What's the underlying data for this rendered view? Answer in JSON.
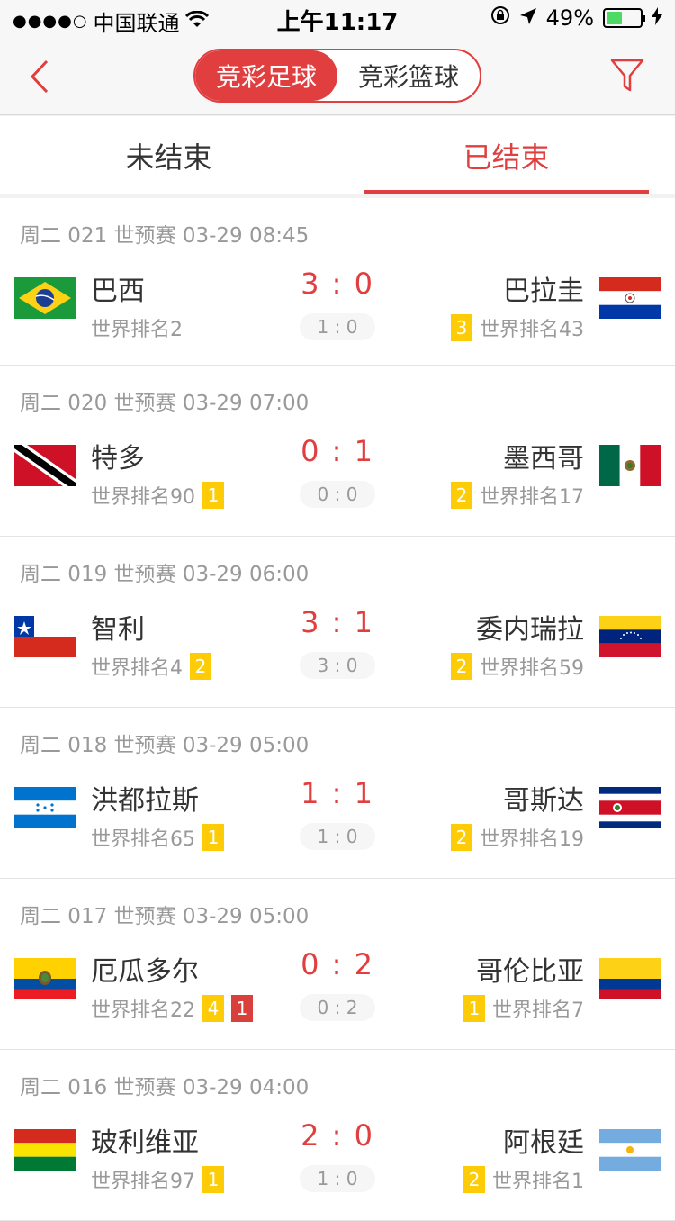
{
  "status_bar": {
    "signal": "●●●●○",
    "carrier": "中国联通",
    "time": "上午11:17",
    "battery_percent": "49%",
    "battery_level": 0.49
  },
  "nav": {
    "seg_football": "竞彩足球",
    "seg_basketball": "竞彩篮球",
    "back_icon": "chevron-left-icon",
    "filter_icon": "funnel-icon"
  },
  "tabs": {
    "unfinished": "未结束",
    "finished": "已结束"
  },
  "colors": {
    "accent": "#e03e3f",
    "yellow_card": "#fdcc06",
    "red_card": "#d9403b",
    "muted": "#999999",
    "half_bg": "#f6f6f6"
  },
  "matches": [
    {
      "header": "周二 021 世预赛 03-29 08:45",
      "home": {
        "name": "巴西",
        "rank": "世界排名2",
        "flag": "brazil-flag-icon",
        "cards": []
      },
      "away": {
        "name": "巴拉圭",
        "rank": "世界排名43",
        "flag": "paraguay-flag-icon",
        "cards": [
          {
            "n": "3",
            "type": "yellow"
          }
        ]
      },
      "score": "3 : 0",
      "half": "1 : 0"
    },
    {
      "header": "周二 020 世预赛 03-29 07:00",
      "home": {
        "name": "特多",
        "rank": "世界排名90",
        "flag": "trinidad-flag-icon",
        "cards": [
          {
            "n": "1",
            "type": "yellow"
          }
        ]
      },
      "away": {
        "name": "墨西哥",
        "rank": "世界排名17",
        "flag": "mexico-flag-icon",
        "cards": [
          {
            "n": "2",
            "type": "yellow"
          }
        ]
      },
      "score": "0 : 1",
      "half": "0 : 0"
    },
    {
      "header": "周二 019 世预赛 03-29 06:00",
      "home": {
        "name": "智利",
        "rank": "世界排名4",
        "flag": "chile-flag-icon",
        "cards": [
          {
            "n": "2",
            "type": "yellow"
          }
        ]
      },
      "away": {
        "name": "委内瑞拉",
        "rank": "世界排名59",
        "flag": "venezuela-flag-icon",
        "cards": [
          {
            "n": "2",
            "type": "yellow"
          }
        ]
      },
      "score": "3 : 1",
      "half": "3 : 0"
    },
    {
      "header": "周二 018 世预赛 03-29 05:00",
      "home": {
        "name": "洪都拉斯",
        "rank": "世界排名65",
        "flag": "honduras-flag-icon",
        "cards": [
          {
            "n": "1",
            "type": "yellow"
          }
        ]
      },
      "away": {
        "name": "哥斯达",
        "rank": "世界排名19",
        "flag": "costa-rica-flag-icon",
        "cards": [
          {
            "n": "2",
            "type": "yellow"
          }
        ]
      },
      "score": "1 : 1",
      "half": "1 : 0"
    },
    {
      "header": "周二 017 世预赛 03-29 05:00",
      "home": {
        "name": "厄瓜多尔",
        "rank": "世界排名22",
        "flag": "ecuador-flag-icon",
        "cards": [
          {
            "n": "4",
            "type": "yellow"
          },
          {
            "n": "1",
            "type": "red"
          }
        ]
      },
      "away": {
        "name": "哥伦比亚",
        "rank": "世界排名7",
        "flag": "colombia-flag-icon",
        "cards": [
          {
            "n": "1",
            "type": "yellow"
          }
        ]
      },
      "score": "0 : 2",
      "half": "0 : 2"
    },
    {
      "header": "周二 016 世预赛 03-29 04:00",
      "home": {
        "name": "玻利维亚",
        "rank": "世界排名97",
        "flag": "bolivia-flag-icon",
        "cards": [
          {
            "n": "1",
            "type": "yellow"
          }
        ]
      },
      "away": {
        "name": "阿根廷",
        "rank": "世界排名1",
        "flag": "argentina-flag-icon",
        "cards": [
          {
            "n": "2",
            "type": "yellow"
          }
        ]
      },
      "score": "2 : 0",
      "half": "1 : 0"
    }
  ]
}
